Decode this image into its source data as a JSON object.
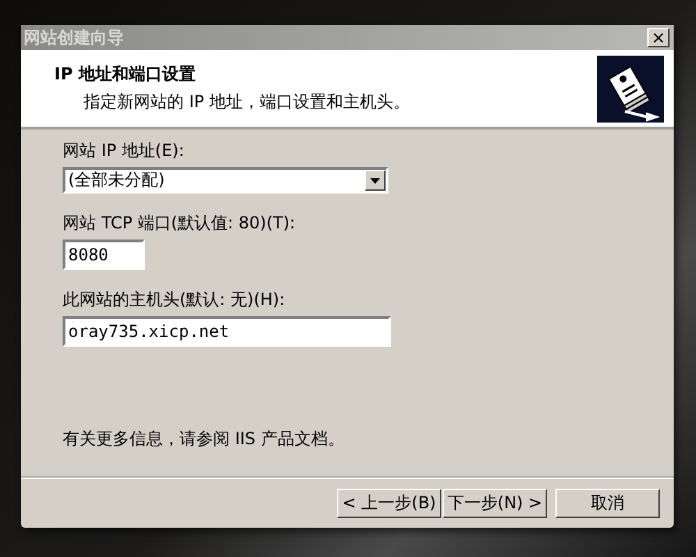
{
  "window": {
    "title": "网站创建向导",
    "close": "×"
  },
  "header": {
    "title": "IP 地址和端口设置",
    "subtitle": "指定新网站的 IP 地址，端口设置和主机头。"
  },
  "fields": [
    {
      "kind": "combo",
      "label": "网站 IP 地址(E):",
      "value": "(全部未分配)"
    },
    {
      "kind": "short",
      "label": "网站 TCP 端口(默认值: 80)(T):",
      "value": "8080"
    },
    {
      "kind": "long",
      "label": "此网站的主机头(默认: 无)(H):",
      "value": "oray735.xicp.net"
    }
  ],
  "info": "有关更多信息，请参阅 IIS 产品文档。",
  "buttons": [
    {
      "label": "< 上一步(B)",
      "kind": "back"
    },
    {
      "label": "下一步(N) >",
      "kind": "next"
    },
    {
      "label": "取消",
      "kind": "cancel"
    }
  ]
}
